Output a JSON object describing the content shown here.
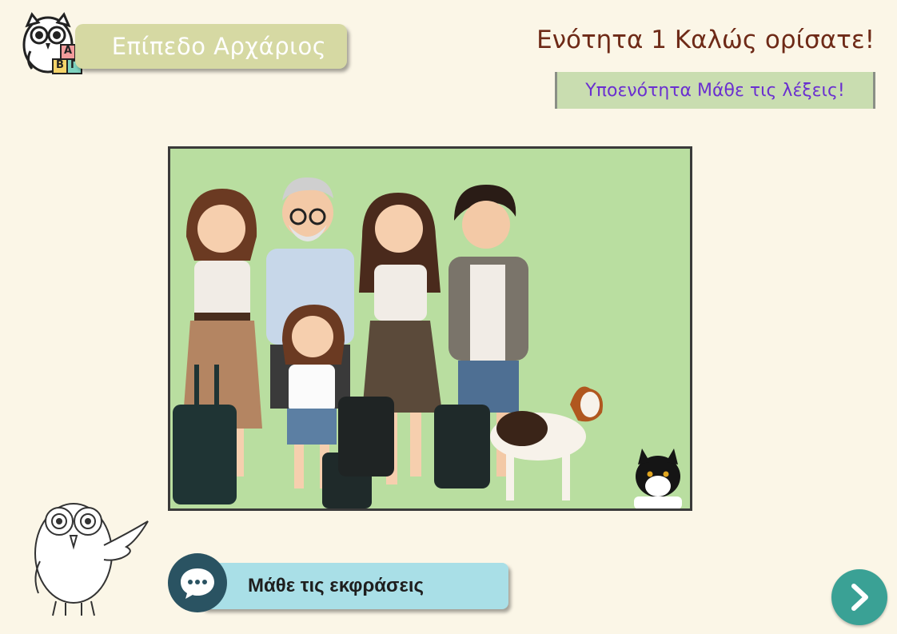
{
  "header": {
    "level_label": "Επίπεδο Αρχάριος",
    "unit_title": "Ενότητα 1 Καλώς ορίσατε!",
    "subunit_label": "Υποενότητα Μάθε τις λέξεις!"
  },
  "logo": {
    "icon": "owl-with-blocks-icon",
    "blocks": [
      "Α",
      "Β",
      "Γ"
    ]
  },
  "illustration": {
    "description_icon": "family-travel-illustration",
    "background_color": "#b9dea0"
  },
  "footer": {
    "expressions_label": "Μάθε τις εκφράσεις",
    "expressions_icon": "speech-bubble-icon",
    "next_icon": "chevron-right-icon",
    "owl_icon": "owl-pointing-icon"
  },
  "colors": {
    "background": "#fbf6e7",
    "level_pill": "#d6d9a3",
    "unit_title": "#6e2a17",
    "subunit_text": "#6a2fd0",
    "subunit_bg": "#c9ddb0",
    "expressions_bg": "#a9dfe7",
    "expressions_icon_bg": "#2a5362",
    "next_button": "#3aa195"
  }
}
